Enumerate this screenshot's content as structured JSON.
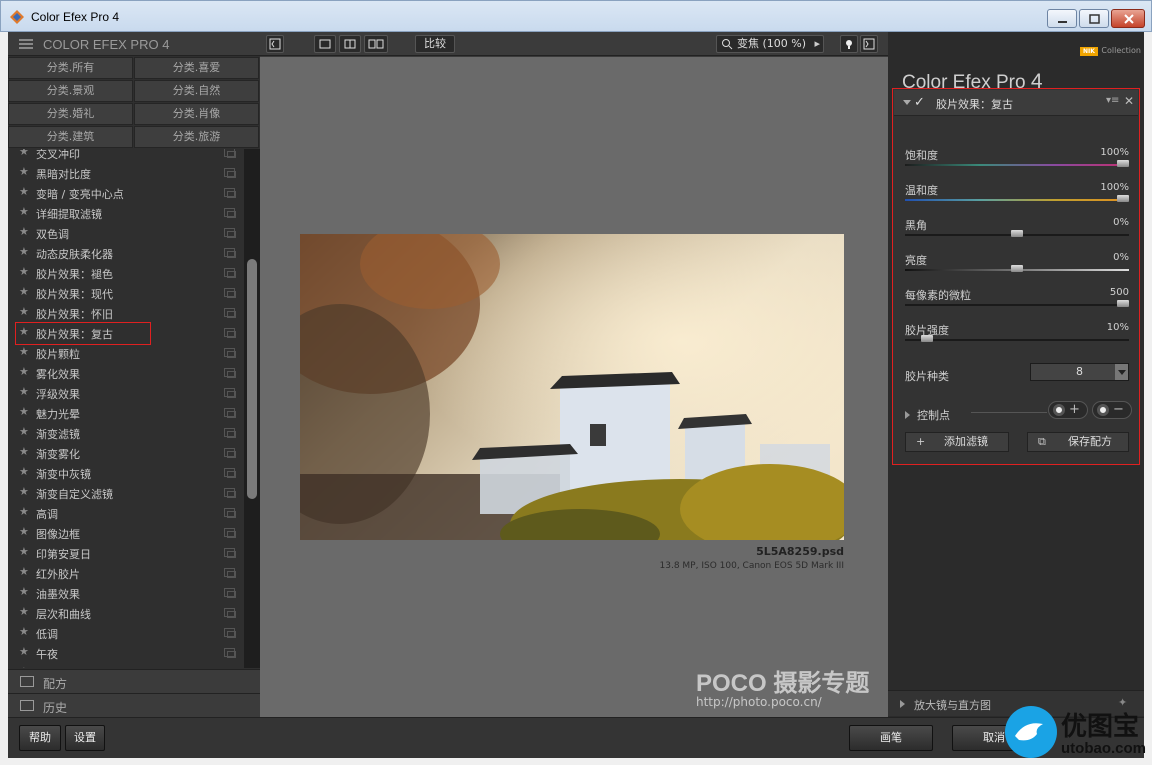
{
  "window": {
    "title": "Color Efex Pro 4"
  },
  "left_panel": {
    "header": "COLOR EFEX PRO 4",
    "categories": [
      "分类.所有",
      "分类.喜爱",
      "分类.景观",
      "分类.自然",
      "分类.婚礼",
      "分类.肖像",
      "分类.建筑",
      "分类.旅游"
    ],
    "filters": [
      "交叉冲印",
      "黑暗对比度",
      "变暗 / 变亮中心点",
      "详细提取滤镜",
      "双色调",
      "动态皮肤柔化器",
      "胶片效果：褪色",
      "胶片效果：现代",
      "胶片效果：怀旧",
      "胶片效果：复古",
      "胶片颗粒",
      "雾化效果",
      "浮级效果",
      "魅力光晕",
      "渐变滤镜",
      "渐变雾化",
      "渐变中灰镜",
      "渐变自定义滤镜",
      "高调",
      "图像边框",
      "印第安夏日",
      "红外胶片",
      "油墨效果",
      "层次和曲线",
      "低调",
      "午夜",
      "…"
    ],
    "selected_filter": "胶片效果：复古",
    "recipes_label": "配方",
    "history_label": "历史"
  },
  "toolbar": {
    "compare_label": "比较",
    "zoom_label": "变焦 (100 %)"
  },
  "preview": {
    "file_name": "5L5A8259.psd",
    "file_meta": "13.8 MP, ISO 100, Canon EOS 5D Mark III",
    "watermark_brand": "POCO 摄影专题",
    "watermark_url": "http://photo.poco.cn/"
  },
  "right_panel": {
    "logo_brand": "NIK",
    "logo_sub": "Collection",
    "title": "Color Efex Pro",
    "title_version": "4",
    "filter_name": "胶片效果：复古",
    "sliders": [
      {
        "name": "饱和度",
        "value": "100%",
        "level": 1.0
      },
      {
        "name": "温和度",
        "value": "100%",
        "level": 1.0
      },
      {
        "name": "黑角",
        "value": "0%",
        "level": 0.5
      },
      {
        "name": "亮度",
        "value": "0%",
        "level": 0.5
      },
      {
        "name": "每像素的微粒",
        "value": "500",
        "level": 1.0
      },
      {
        "name": "胶片强度",
        "value": "10%",
        "level": 0.1
      }
    ],
    "film_type_label": "胶片种类",
    "film_type_value": "8",
    "control_points_label": "控制点",
    "add_filter_label": "添加滤镜",
    "save_recipe_label": "保存配方",
    "loupe_label": "放大镜与直方图"
  },
  "bottom": {
    "help_label": "帮助",
    "settings_label": "设置",
    "brush_label": "画笔",
    "cancel_label": "取消"
  },
  "overlay": {
    "site_name": "优图宝",
    "site_url": "utobao.com"
  },
  "colors": {
    "accent_red": "#e02020",
    "panel_bg": "#2f2f2f",
    "canvas_bg": "#6a6a6a"
  }
}
